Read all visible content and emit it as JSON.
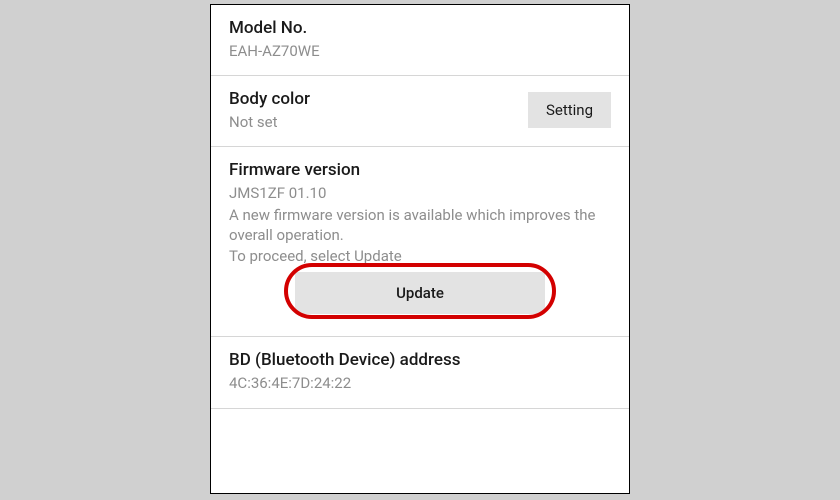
{
  "rows": {
    "model": {
      "title": "Model No.",
      "value": "EAH-AZ70WE"
    },
    "bodyColor": {
      "title": "Body color",
      "value": "Not set",
      "button": "Setting"
    },
    "firmware": {
      "title": "Firmware version",
      "value": "JMS1ZF 01.10",
      "desc1": "A new firmware version is available which improves the overall operation.",
      "desc2": "To proceed, select Update",
      "button": "Update"
    },
    "bd": {
      "title": "BD (Bluetooth Device) address",
      "value": "4C:36:4E:7D:24:22"
    }
  }
}
